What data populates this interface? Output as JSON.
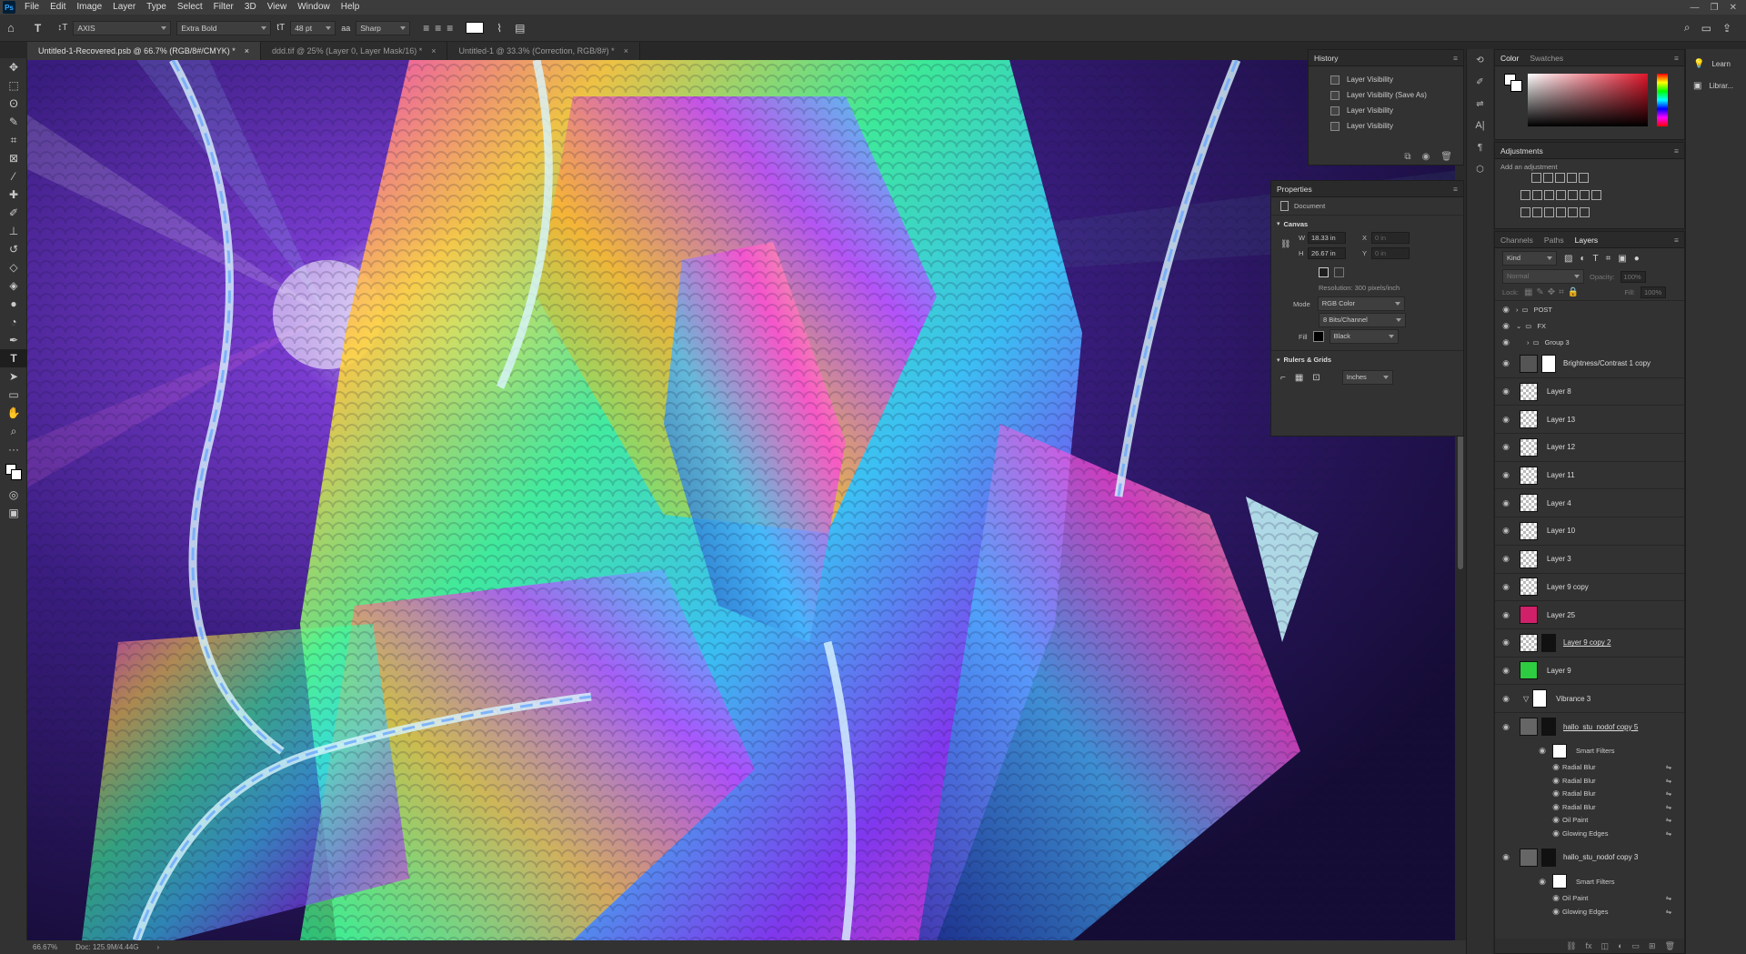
{
  "app": {
    "badge": "Ps"
  },
  "menu": [
    "File",
    "Edit",
    "Image",
    "Layer",
    "Type",
    "Select",
    "Filter",
    "3D",
    "View",
    "Window",
    "Help"
  ],
  "options": {
    "font_family": "AXIS",
    "font_style": "Extra Bold",
    "font_size": "48 pt",
    "antialias": "Sharp",
    "text_color": "#ffffff"
  },
  "tabs": [
    {
      "label": "Untitled-1-Recovered.psb @ 66.7% (RGB/8#/CMYK) *",
      "active": true
    },
    {
      "label": "ddd.tif @ 25% (Layer 0, Layer Mask/16) *",
      "active": false
    },
    {
      "label": "Untitled-1 @ 33.3% (Correction, RGB/8#) *",
      "active": false
    }
  ],
  "status": {
    "zoom": "66.67%",
    "doc": "Doc: 125.9M/4.44G"
  },
  "history": {
    "title": "History",
    "items": [
      "Layer Visibility",
      "Layer Visibility (Save As)",
      "Layer Visibility",
      "Layer Visibility"
    ]
  },
  "properties": {
    "title": "Properties",
    "doc_label": "Document",
    "canvas_label": "Canvas",
    "w_label": "W",
    "w_value": "18.33 in",
    "h_label": "H",
    "h_value": "26.67 in",
    "x_label": "X",
    "x_value": "0 in",
    "y_label": "Y",
    "y_value": "0 in",
    "resolution": "Resolution: 300 pixels/inch",
    "mode_label": "Mode",
    "mode_value": "RGB Color",
    "bits_value": "8 Bits/Channel",
    "fill_label": "Fill",
    "fill_value": "Black",
    "rulers_label": "Rulers & Grids",
    "units_value": "Inches"
  },
  "color_panel": {
    "tab1": "Color",
    "tab2": "Swatches"
  },
  "adjustments": {
    "title": "Adjustments",
    "hint": "Add an adjustment"
  },
  "layers_panel": {
    "tabs": [
      "Channels",
      "Paths",
      "Layers"
    ],
    "filter_kind": "Kind",
    "blend_mode": "Normal",
    "opacity_label": "Opacity:",
    "opacity_value": "100%",
    "lock_label": "Lock:",
    "fill_label": "Fill:",
    "fill_value": "100%",
    "groups": [
      "POST",
      "FX",
      "Group 3"
    ],
    "layers": [
      "Brightness/Contrast 1 copy",
      "Layer 8",
      "Layer 13",
      "Layer 12",
      "Layer 11",
      "Layer 4",
      "Layer 10",
      "Layer 3",
      "Layer 9 copy",
      "Layer 25",
      "Layer 9 copy 2",
      "Layer 9",
      "Vibrance 3",
      "hallo_stu_nodof copy 5"
    ],
    "smart_filters_label": "Smart Filters",
    "filters_a": [
      "Radial Blur",
      "Radial Blur",
      "Radial Blur",
      "Radial Blur",
      "Oil Paint",
      "Glowing Edges"
    ],
    "layer_b": "hallo_stu_nodof copy 3",
    "filters_b": [
      "Oil Paint",
      "Glowing Edges"
    ]
  },
  "learn": {
    "learn_label": "Learn",
    "libraries_label": "Librar..."
  }
}
